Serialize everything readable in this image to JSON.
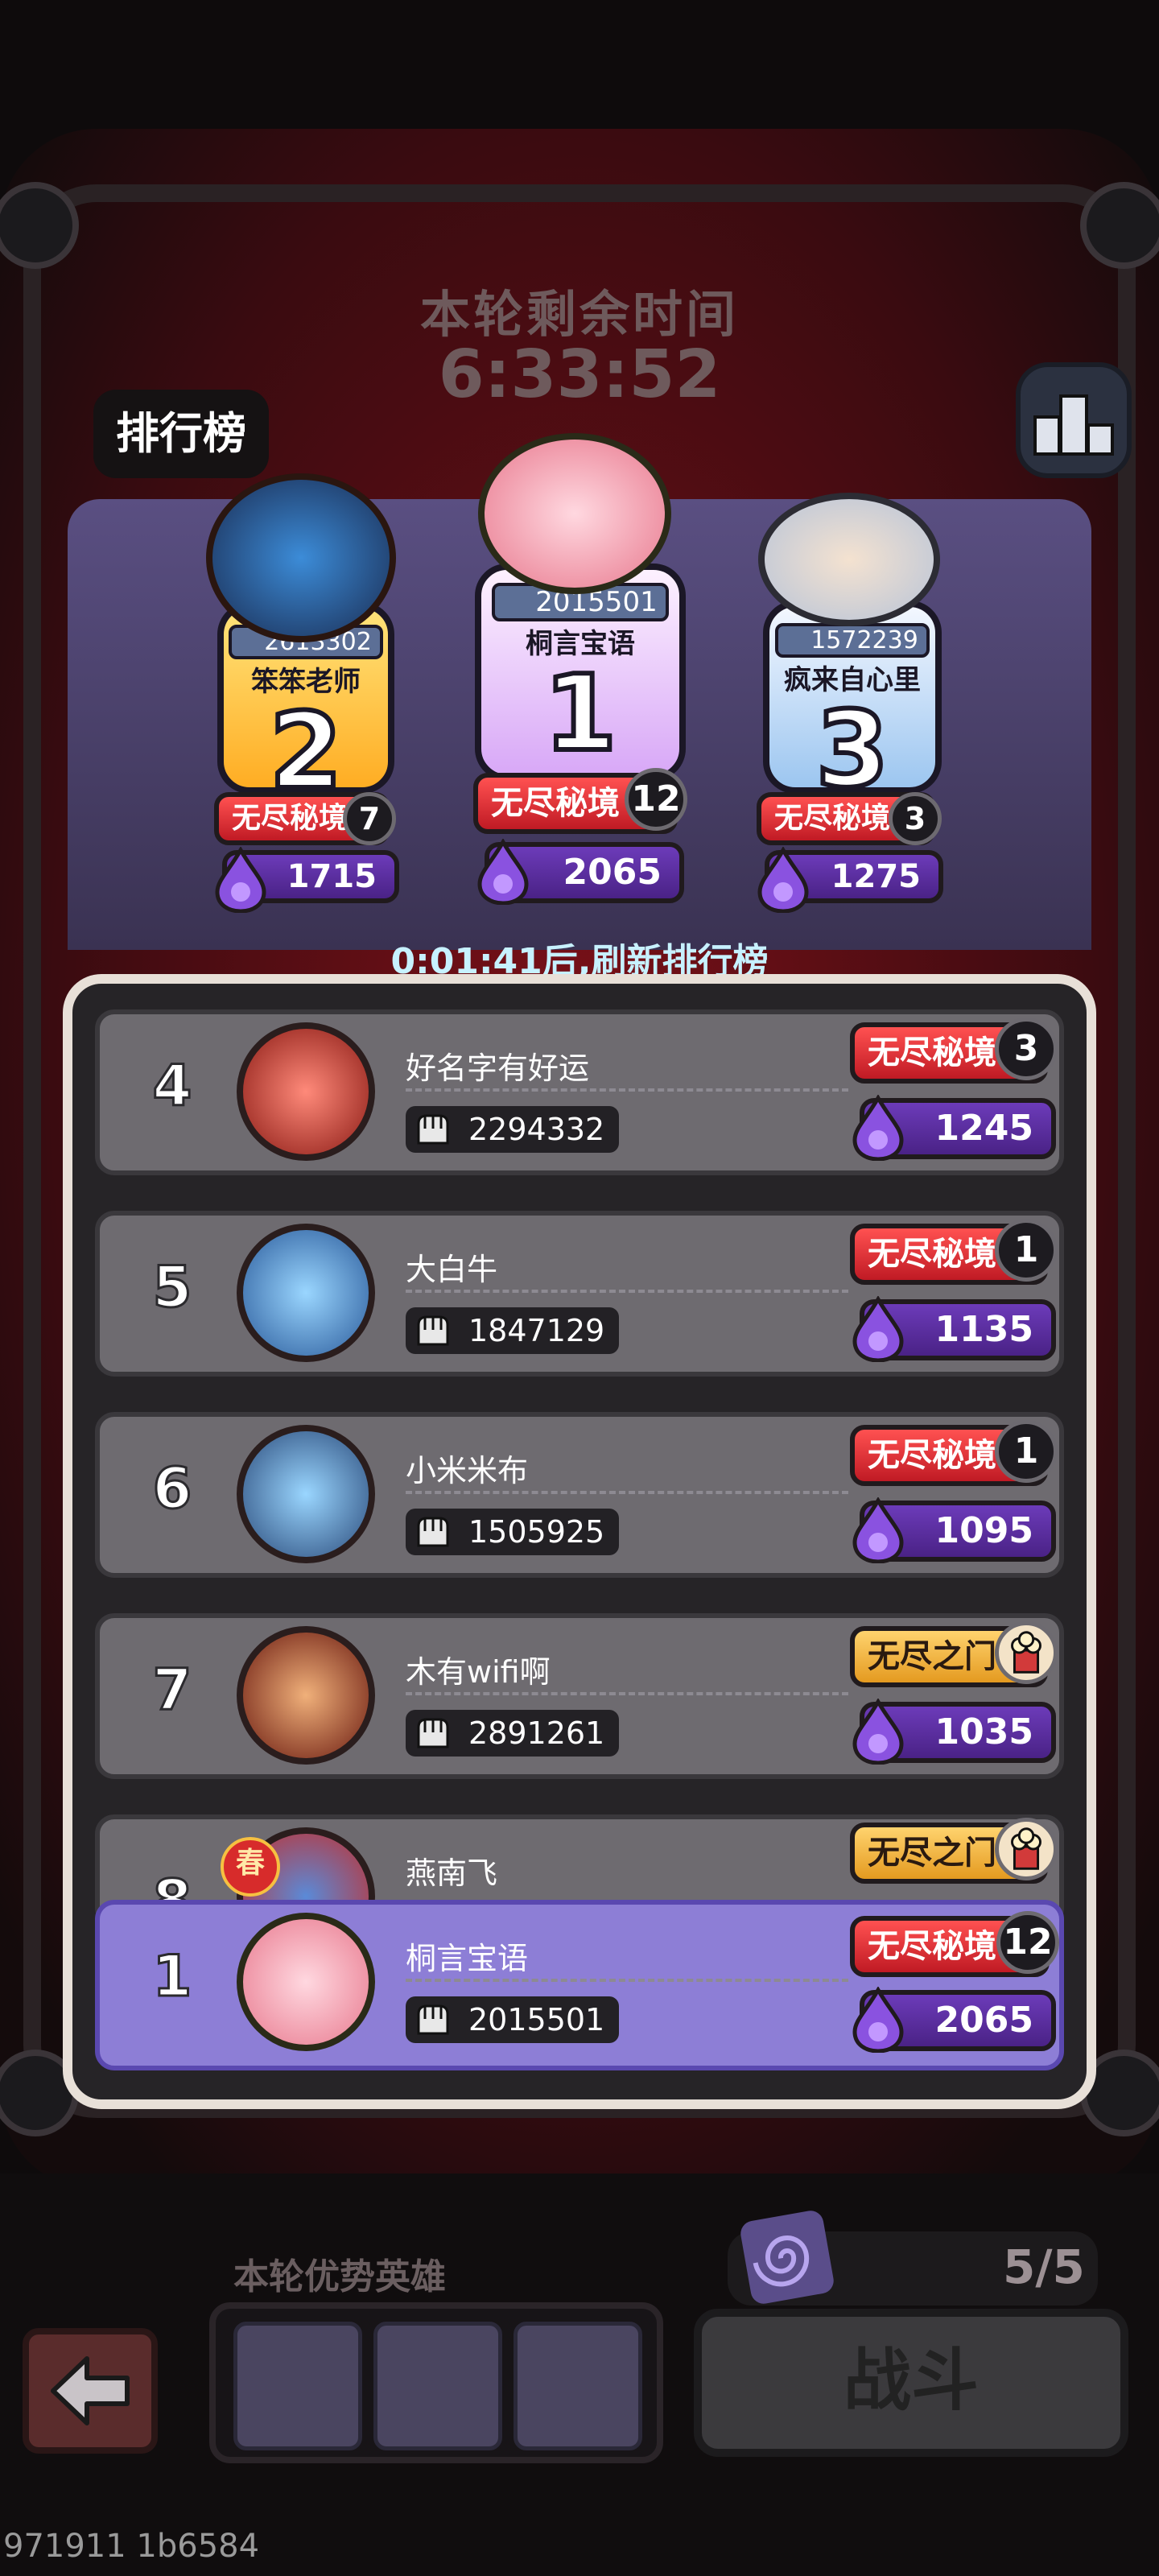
{
  "timer": {
    "title": "本轮剩余时间",
    "value": "6:33:52"
  },
  "leaderboard_tab": "排行榜",
  "refresh_text": "0:01:41后,刷新排行榜",
  "top3": [
    {
      "position": "1",
      "score": "2015501",
      "name": "桐言宝语",
      "mode": "无尽秘境",
      "level": "12",
      "points": "2065"
    },
    {
      "position": "2",
      "score": "2613302",
      "name": "笨笨老师",
      "mode": "无尽秘境",
      "level": "7",
      "points": "1715"
    },
    {
      "position": "3",
      "score": "1572239",
      "name": "疯来自心里",
      "mode": "无尽秘境",
      "level": "3",
      "points": "1275"
    }
  ],
  "list": [
    {
      "rank": "4",
      "name": "好名字有好运",
      "score": "2294332",
      "mode": "无尽秘境",
      "level": "3",
      "points": "1245",
      "mode_style": "red"
    },
    {
      "rank": "5",
      "name": "大白牛",
      "score": "1847129",
      "mode": "无尽秘境",
      "level": "1",
      "points": "1135",
      "mode_style": "red"
    },
    {
      "rank": "6",
      "name": "小米米布",
      "score": "1505925",
      "mode": "无尽秘境",
      "level": "1",
      "points": "1095",
      "mode_style": "red"
    },
    {
      "rank": "7",
      "name": "木有wifi啊",
      "score": "2891261",
      "mode": "无尽之门",
      "level": "",
      "points": "1035",
      "mode_style": "gold"
    },
    {
      "rank": "8",
      "name": "燕南飞",
      "score": "",
      "mode": "无尽之门",
      "level": "",
      "points": "",
      "mode_style": "gold"
    }
  ],
  "me": {
    "rank": "1",
    "name": "桐言宝语",
    "score": "2015501",
    "mode": "无尽秘境",
    "level": "12",
    "points": "2065"
  },
  "bottom": {
    "hero_label": "本轮优势英雄",
    "stamina": "5/5",
    "fight_label": "战斗"
  },
  "spring_badge": "春",
  "debug_text": "971911 1b6584",
  "icons": [
    "trophy-podium-icon",
    "fist-icon",
    "purple-drop-icon",
    "popcorn-icon",
    "back-arrow-icon",
    "spiral-icon"
  ]
}
